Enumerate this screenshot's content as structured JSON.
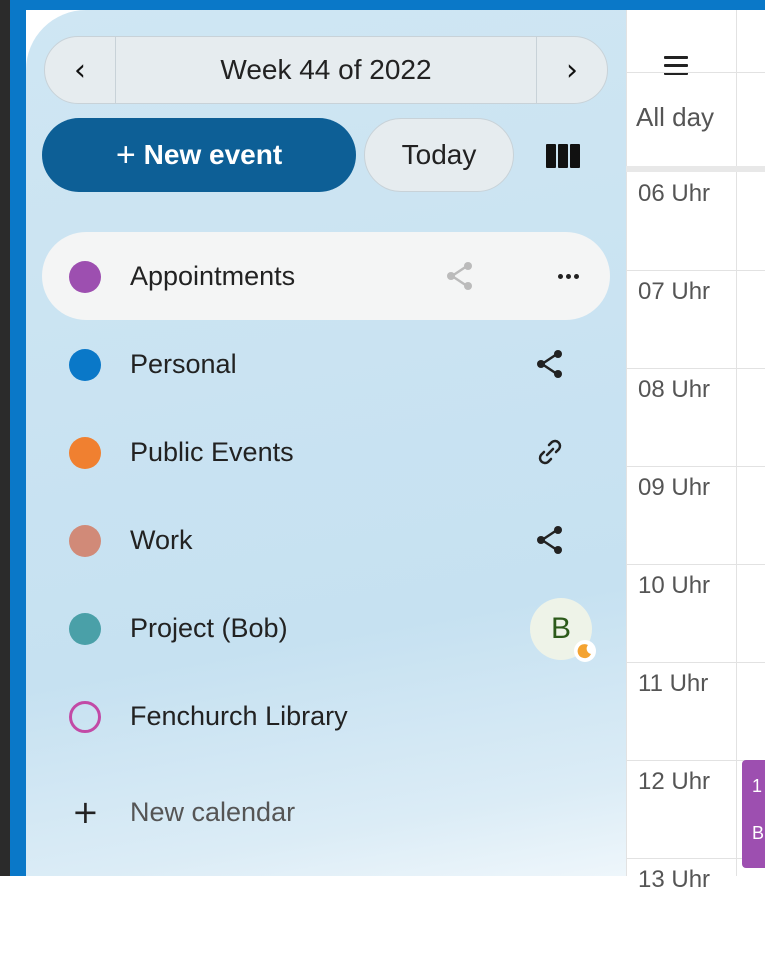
{
  "nav": {
    "week_label": "Week 44 of 2022",
    "prev_icon": "chevron-left-icon",
    "next_icon": "chevron-right-icon"
  },
  "actions": {
    "new_event_label": "New event",
    "today_label": "Today",
    "view_icon": "columns-icon"
  },
  "calendars": [
    {
      "name": "Appointments",
      "color": "#9d4fb0",
      "action": "share-icon",
      "active": true
    },
    {
      "name": "Personal",
      "color": "#0a78c8",
      "action": "share-icon"
    },
    {
      "name": "Public Events",
      "color": "#f08030",
      "action": "link-icon"
    },
    {
      "name": "Work",
      "color": "#d18a78",
      "action": "share-icon"
    },
    {
      "name": "Project (Bob)",
      "color": "#4aa0a8",
      "action": "avatar",
      "avatar_letter": "B"
    },
    {
      "name": "Fenchurch Library",
      "color": "#c24aa6",
      "action": "none",
      "hollow": true
    }
  ],
  "new_calendar_label": "New calendar",
  "grid": {
    "all_day_label": "All day",
    "hours": [
      "06 Uhr",
      "07 Uhr",
      "08 Uhr",
      "09 Uhr",
      "10 Uhr",
      "11 Uhr",
      "12 Uhr",
      "13 Uhr"
    ],
    "event_snippet": [
      "1",
      "B"
    ]
  }
}
